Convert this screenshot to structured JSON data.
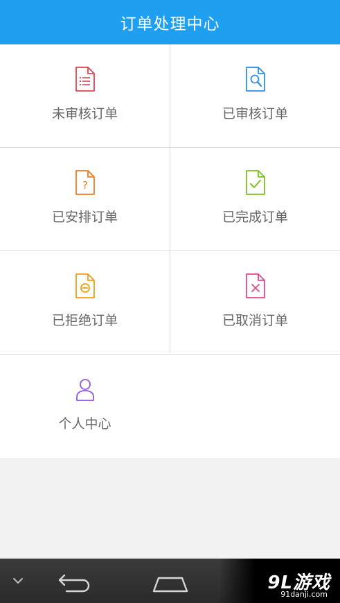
{
  "header": {
    "title": "订单处理中心"
  },
  "menu": [
    {
      "label": "未审核订单",
      "icon": "doc-list-icon",
      "color": "#e0434f"
    },
    {
      "label": "已审核订单",
      "icon": "doc-search-icon",
      "color": "#2a8ff0"
    },
    {
      "label": "已安排订单",
      "icon": "doc-question-icon",
      "color": "#f07a22"
    },
    {
      "label": "已完成订单",
      "icon": "doc-check-icon",
      "color": "#7cc11f"
    },
    {
      "label": "已拒绝订单",
      "icon": "doc-minus-icon",
      "color": "#f29c10"
    },
    {
      "label": "已取消订单",
      "icon": "doc-cancel-icon",
      "color": "#e8458a"
    },
    {
      "label": "个人中心",
      "icon": "user-icon",
      "color": "#8a57e6"
    }
  ],
  "navbar": {
    "watermark_logo": "9L游戏",
    "watermark_url": "91danji.com"
  }
}
